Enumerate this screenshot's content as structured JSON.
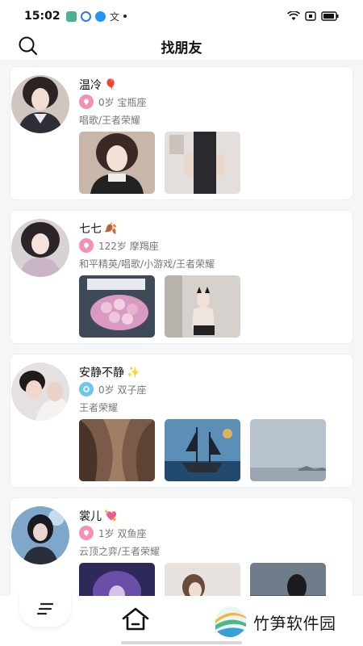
{
  "status_bar": {
    "time": "15:02",
    "input_char": "文"
  },
  "header": {
    "title": "找朋友"
  },
  "cards": [
    {
      "name": "温冷",
      "emoji": "🎈",
      "age_sign": "0岁 宝瓶座",
      "tags": "唱歌/王者荣耀",
      "gender": "female",
      "photo_count": 2
    },
    {
      "name": "七七",
      "emoji": "🍂",
      "age_sign": "122岁 摩羯座",
      "tags": "和平精英/唱歌/小游戏/王者荣耀",
      "gender": "female",
      "photo_count": 2
    },
    {
      "name": "安静不静",
      "emoji": "✨",
      "age_sign": "0岁 双子座",
      "tags": "王者荣耀",
      "gender": "male",
      "photo_count": 3
    },
    {
      "name": "裳儿",
      "emoji": "💘",
      "age_sign": "1岁 双鱼座",
      "tags": "云顶之弈/王者荣耀",
      "gender": "female",
      "photo_count": 3
    }
  ],
  "tab_bar": {
    "items": [
      "filter-tab",
      "home-tab"
    ]
  },
  "watermark": {
    "text": "竹笋软件园"
  },
  "colors": {
    "female": "#f48fb8",
    "male": "#6ec6ee"
  }
}
